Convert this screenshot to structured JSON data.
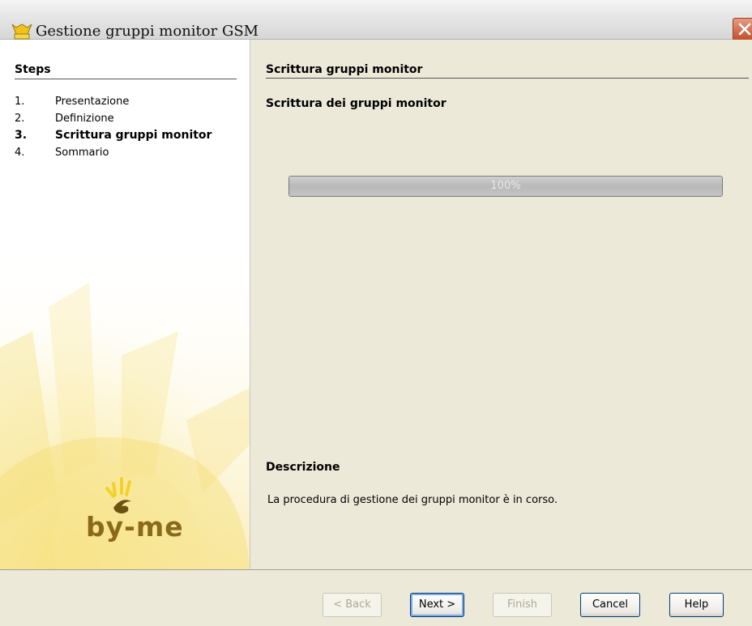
{
  "window": {
    "title": "Gestione gruppi monitor GSM"
  },
  "steps": {
    "header": "Steps",
    "items": [
      {
        "num": "1.",
        "label": "Presentazione"
      },
      {
        "num": "2.",
        "label": "Definizione"
      },
      {
        "num": "3.",
        "label": "Scrittura gruppi monitor"
      },
      {
        "num": "4.",
        "label": "Sommario"
      }
    ],
    "current_index": 2
  },
  "logo": {
    "text": "by-me"
  },
  "main": {
    "section_title": "Scrittura gruppi monitor",
    "subtitle": "Scrittura dei gruppi monitor",
    "progress": {
      "value": 1.0,
      "label": "100%"
    },
    "description_header": "Descrizione",
    "description_text": "La procedura di gestione dei gruppi monitor è in corso."
  },
  "buttons": {
    "back": "< Back",
    "next": "Next >",
    "finish": "Finish",
    "cancel": "Cancel",
    "help": "Help"
  },
  "colors": {
    "accent_yellow": "#f4d23c",
    "window_bg": "#ece9d8",
    "button_border": "#003c74"
  }
}
